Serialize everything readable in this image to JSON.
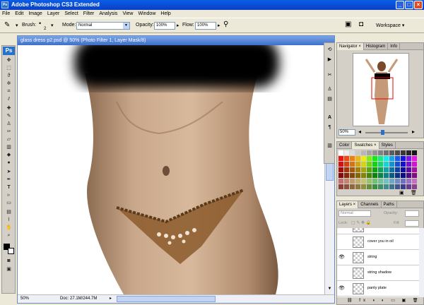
{
  "app": {
    "title": "Adobe Photoshop CS3 Extended",
    "icon": "photoshop-icon"
  },
  "window_controls": {
    "minimize": "_",
    "maximize": "□",
    "close": "×"
  },
  "menu": [
    "File",
    "Edit",
    "Image",
    "Layer",
    "Select",
    "Filter",
    "Analysis",
    "View",
    "Window",
    "Help"
  ],
  "options": {
    "brush_label": "Brush:",
    "brush_size": "2",
    "mode_label": "Mode:",
    "mode_value": "Normal",
    "opacity_label": "Opacity:",
    "opacity_value": "100%",
    "flow_label": "Flow:",
    "flow_value": "100%",
    "workspace": "Workspace ▾"
  },
  "document": {
    "title": "glass dress p2.psd @ 50% (Photo Filter 1, Layer Mask/8)",
    "zoom": "50%",
    "doc_info": "Doc: 27.1M/244.7M"
  },
  "tools": {
    "ps_label": "Ps"
  },
  "navigator": {
    "tabs": [
      "Navigator",
      "Histogram",
      "Info"
    ],
    "zoom": "50%"
  },
  "swatches": {
    "tabs": [
      "Color",
      "Swatches",
      "Styles"
    ]
  },
  "layers": {
    "tabs": [
      "Layers",
      "Channels",
      "Paths"
    ],
    "blend": "Normal",
    "opacity_label": "Opacity:",
    "lock_label": "Lock:",
    "fill_label": "Fill:",
    "rows": [
      {
        "name": "",
        "visible": false
      },
      {
        "name": "cover you in oil",
        "visible": false
      },
      {
        "name": "string",
        "visible": true
      },
      {
        "name": "string shadow",
        "visible": false
      },
      {
        "name": "panty plate",
        "visible": true
      }
    ]
  },
  "colors": {
    "titlebar": "#0a4fd8",
    "accent": "#2a72c9"
  }
}
